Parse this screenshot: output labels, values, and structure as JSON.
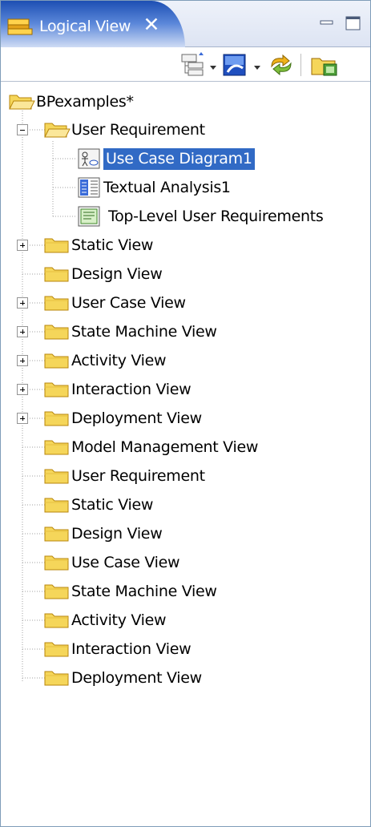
{
  "tab": {
    "title": "Logical View",
    "close_glyph": "✕"
  },
  "window_controls": {
    "minimize": "minimize-icon",
    "maximize": "maximize-icon"
  },
  "toolbar": {
    "buttons": [
      "collapse-all-icon",
      "dropdown-arrow-icon",
      "layout-icon",
      "dropdown-arrow-icon",
      "sync-arrows-icon",
      "new-folder-icon"
    ]
  },
  "tree": {
    "root": "BPexamples*",
    "requirement_folder": "User Requirement",
    "children": [
      "Use Case Diagram1",
      "Textual Analysis1",
      "Top-Level User Requirements"
    ],
    "folders": [
      "Static View",
      "Design View",
      "User Case View",
      "State Machine View",
      "Activity View",
      "Interaction View",
      "Deployment View",
      "Model Management View",
      "User Requirement",
      "Static View",
      "Design View",
      "Use Case View",
      "State Machine View",
      "Activity View",
      "Interaction View",
      "Deployment View"
    ],
    "selected": "Use Case Diagram1"
  },
  "colors": {
    "tab_dark": "#1d4fb3",
    "selection": "#316ac5",
    "folder_fill": "#f5d65a",
    "folder_stroke": "#b8860b"
  }
}
